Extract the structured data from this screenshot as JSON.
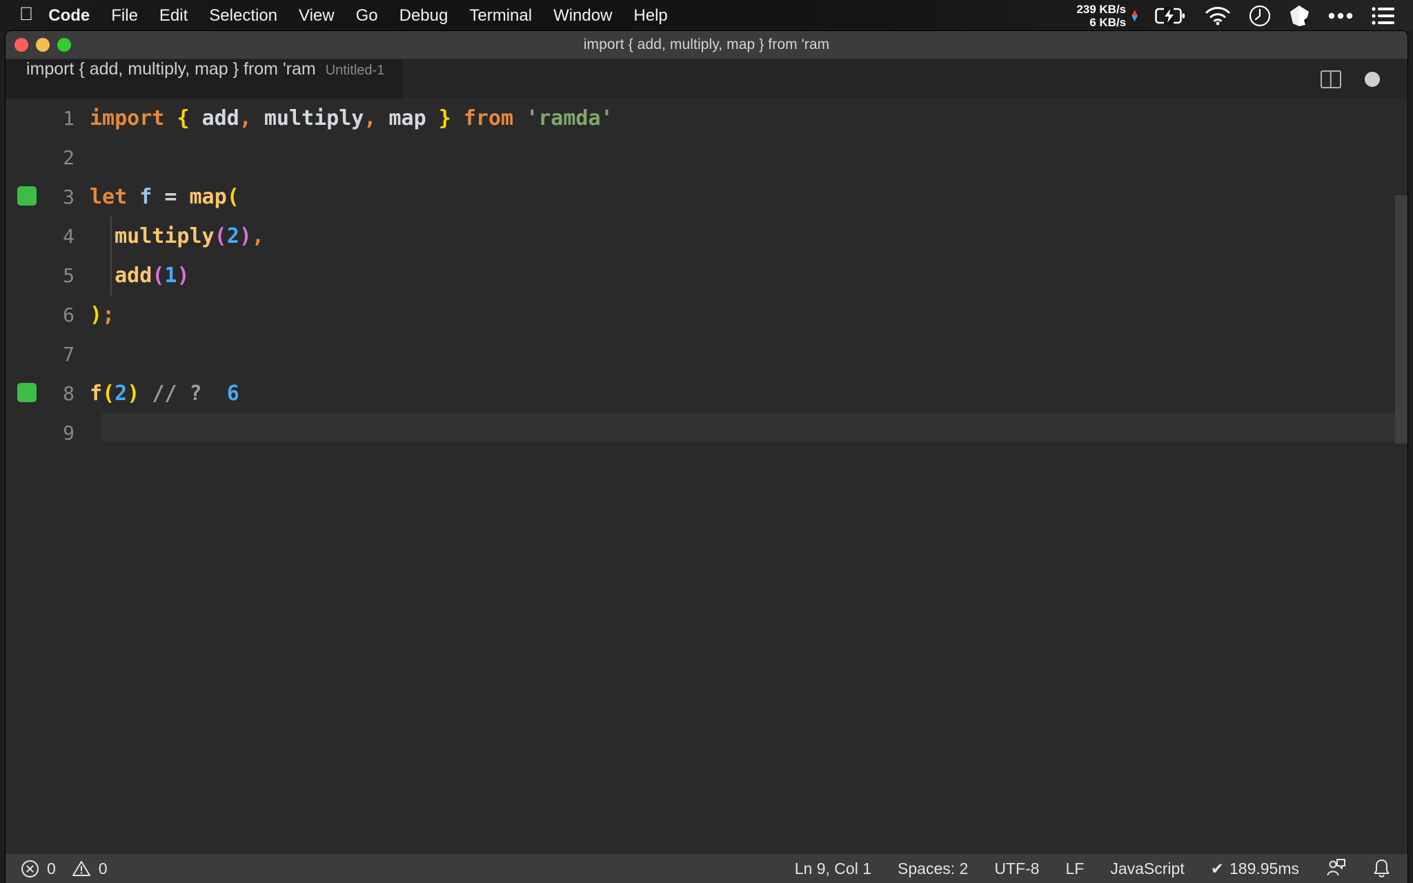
{
  "menubar": {
    "apple_icon": "apple-icon",
    "items": [
      {
        "label": "Code",
        "bold": true
      },
      {
        "label": "File",
        "bold": false
      },
      {
        "label": "Edit",
        "bold": false
      },
      {
        "label": "Selection",
        "bold": false
      },
      {
        "label": "View",
        "bold": false
      },
      {
        "label": "Go",
        "bold": false
      },
      {
        "label": "Debug",
        "bold": false
      },
      {
        "label": "Terminal",
        "bold": false
      },
      {
        "label": "Window",
        "bold": false
      },
      {
        "label": "Help",
        "bold": false
      }
    ],
    "tray": {
      "upload_speed": "239 KB/s",
      "download_speed": "6 KB/s",
      "up_arrow_color": "#ef4034",
      "down_arrow_color": "#3fa3f0",
      "icons": [
        "battery-charging-icon",
        "wifi-icon",
        "clock-icon",
        "dropbox-icon",
        "ellipsis-icon",
        "control-center-list-icon"
      ]
    }
  },
  "window": {
    "title": "import { add, multiply, map } from 'ram",
    "traffic_lights": [
      "close-button",
      "minimize-button",
      "zoom-button"
    ]
  },
  "tab": {
    "title": "import { add, multiply, map } from 'ram",
    "subtitle": "Untitled-1",
    "actions": [
      "split-editor-icon",
      "unsaved-dot-icon"
    ]
  },
  "editor": {
    "lines": [
      {
        "number": "1",
        "marker": false,
        "indent_guide": false,
        "tokens": [
          {
            "text": "import",
            "cls": "t-kw"
          },
          {
            "text": " ",
            "cls": "t-op"
          },
          {
            "text": "{",
            "cls": "t-br-y"
          },
          {
            "text": " add",
            "cls": "t-var"
          },
          {
            "text": ",",
            "cls": "t-punc"
          },
          {
            "text": " multiply",
            "cls": "t-var"
          },
          {
            "text": ",",
            "cls": "t-punc"
          },
          {
            "text": " map ",
            "cls": "t-var"
          },
          {
            "text": "}",
            "cls": "t-br-y"
          },
          {
            "text": " ",
            "cls": "t-op"
          },
          {
            "text": "from",
            "cls": "t-kw"
          },
          {
            "text": " ",
            "cls": "t-op"
          },
          {
            "text": "'ramda'",
            "cls": "t-str"
          }
        ]
      },
      {
        "number": "2",
        "marker": false,
        "indent_guide": false,
        "tokens": []
      },
      {
        "number": "3",
        "marker": true,
        "indent_guide": false,
        "tokens": [
          {
            "text": "let",
            "cls": "t-kw"
          },
          {
            "text": " ",
            "cls": "t-op"
          },
          {
            "text": "f",
            "cls": "t-param"
          },
          {
            "text": " ",
            "cls": "t-op"
          },
          {
            "text": "=",
            "cls": "t-op"
          },
          {
            "text": " ",
            "cls": "t-op"
          },
          {
            "text": "map",
            "cls": "t-fn"
          },
          {
            "text": "(",
            "cls": "t-br-y"
          }
        ]
      },
      {
        "number": "4",
        "marker": false,
        "indent_guide": true,
        "tokens": [
          {
            "text": "  ",
            "cls": "t-op"
          },
          {
            "text": "multiply",
            "cls": "t-fn"
          },
          {
            "text": "(",
            "cls": "t-br-m"
          },
          {
            "text": "2",
            "cls": "t-num"
          },
          {
            "text": ")",
            "cls": "t-br-m"
          },
          {
            "text": ",",
            "cls": "t-punc"
          }
        ]
      },
      {
        "number": "5",
        "marker": false,
        "indent_guide": true,
        "tokens": [
          {
            "text": "  ",
            "cls": "t-op"
          },
          {
            "text": "add",
            "cls": "t-fn"
          },
          {
            "text": "(",
            "cls": "t-br-m"
          },
          {
            "text": "1",
            "cls": "t-num"
          },
          {
            "text": ")",
            "cls": "t-br-m"
          }
        ]
      },
      {
        "number": "6",
        "marker": false,
        "indent_guide": false,
        "tokens": [
          {
            "text": ")",
            "cls": "t-br-y"
          },
          {
            "text": ";",
            "cls": "t-punc"
          }
        ]
      },
      {
        "number": "7",
        "marker": false,
        "indent_guide": false,
        "tokens": []
      },
      {
        "number": "8",
        "marker": true,
        "indent_guide": false,
        "tokens": [
          {
            "text": "f",
            "cls": "t-fn"
          },
          {
            "text": "(",
            "cls": "t-br-y"
          },
          {
            "text": "2",
            "cls": "t-num"
          },
          {
            "text": ")",
            "cls": "t-br-y"
          },
          {
            "text": " ",
            "cls": "t-op"
          },
          {
            "text": "// ?",
            "cls": "t-cmt"
          },
          {
            "text": "  ",
            "cls": "t-op"
          },
          {
            "text": "6",
            "cls": "t-res"
          }
        ]
      },
      {
        "number": "9",
        "marker": false,
        "indent_guide": false,
        "cursor": true,
        "tokens": []
      }
    ]
  },
  "statusbar": {
    "error_icon": "error-circle-icon",
    "error_count": "0",
    "warning_icon": "warning-triangle-icon",
    "warning_count": "0",
    "position": "Ln 9, Col 1",
    "indentation": "Spaces: 2",
    "encoding": "UTF-8",
    "eol": "LF",
    "language": "JavaScript",
    "quokka_status": "189.95ms",
    "quokka_check": "✔",
    "feedback_icon": "feedback-smiley-icon",
    "bell_icon": "notification-bell-icon"
  }
}
